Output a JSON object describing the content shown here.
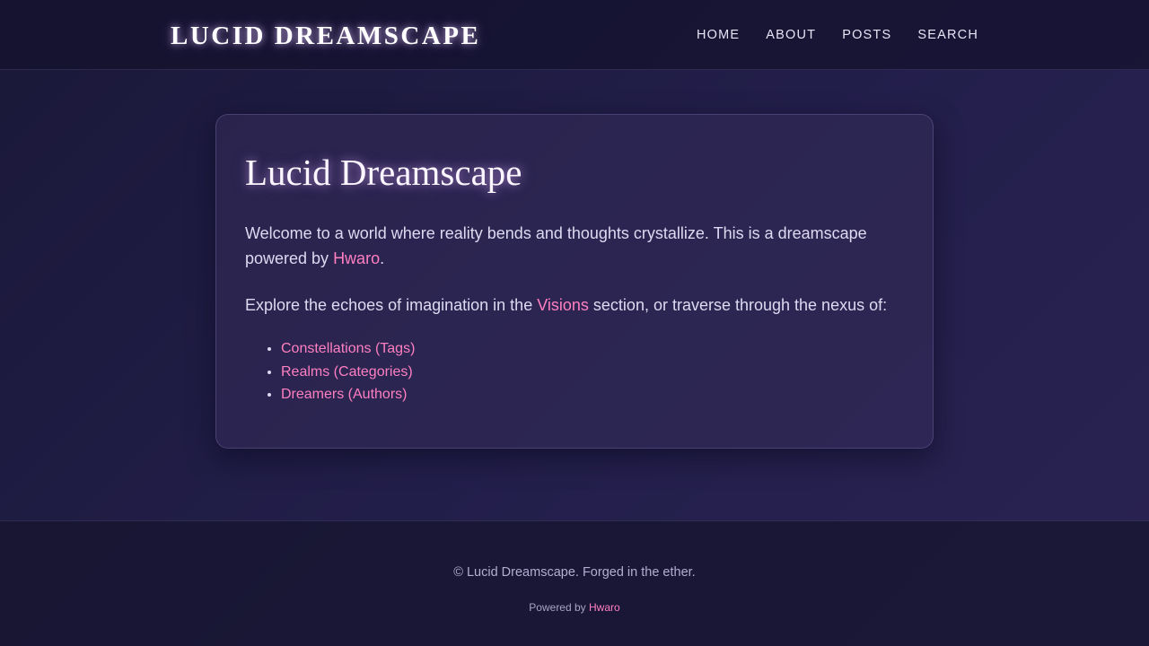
{
  "header": {
    "brand": "LUCID DREAMSCAPE",
    "nav": [
      {
        "label": "HOME"
      },
      {
        "label": "ABOUT"
      },
      {
        "label": "POSTS"
      },
      {
        "label": "SEARCH"
      }
    ]
  },
  "main": {
    "title": "Lucid Dreamscape",
    "intro_before": "Welcome to a world where reality bends and thoughts crystallize. This is a dreamscape powered by ",
    "intro_link": "Hwaro",
    "intro_after": ".",
    "explore_before": "Explore the echoes of imagination in the ",
    "explore_link": "Visions",
    "explore_after": " section, or traverse through the nexus of:",
    "links": [
      {
        "label": "Constellations (Tags)"
      },
      {
        "label": "Realms (Categories)"
      },
      {
        "label": "Dreamers (Authors)"
      }
    ]
  },
  "footer": {
    "copyright": "© Lucid Dreamscape. Forged in the ether.",
    "powered_prefix": "Powered by ",
    "powered_link": "Hwaro"
  },
  "colors": {
    "accent": "#ff7fc1",
    "background": "#221e4a",
    "text": "#dedaf2"
  }
}
